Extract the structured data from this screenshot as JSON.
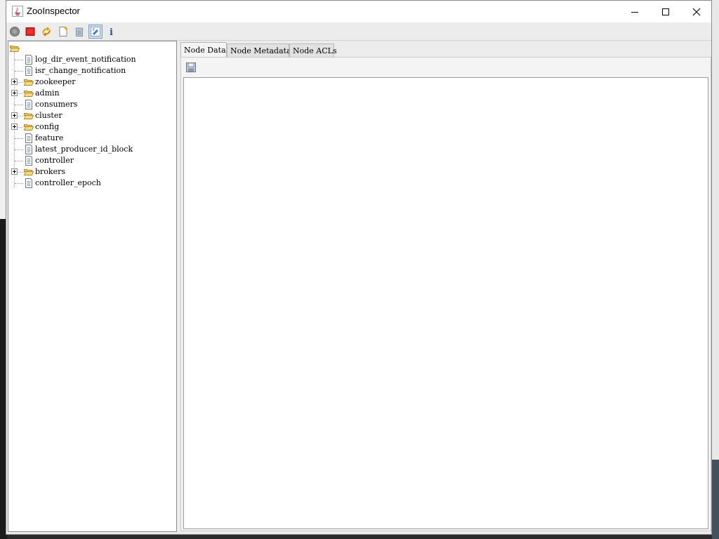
{
  "window": {
    "title": "ZooInspector"
  },
  "toolbar": {
    "buttons": [
      {
        "name": "connect-icon"
      },
      {
        "name": "disconnect-icon"
      },
      {
        "name": "refresh-icon"
      },
      {
        "name": "add-node-icon"
      },
      {
        "name": "delete-node-icon"
      },
      {
        "name": "node-viewers-icon"
      },
      {
        "name": "about-icon"
      }
    ]
  },
  "tree": {
    "root": "",
    "items": [
      {
        "label": "log_dir_event_notification",
        "type": "file",
        "expandable": false
      },
      {
        "label": "isr_change_notification",
        "type": "file",
        "expandable": false
      },
      {
        "label": "zookeeper",
        "type": "folder",
        "expandable": true
      },
      {
        "label": "admin",
        "type": "folder",
        "expandable": true
      },
      {
        "label": "consumers",
        "type": "file",
        "expandable": false
      },
      {
        "label": "cluster",
        "type": "folder",
        "expandable": true
      },
      {
        "label": "config",
        "type": "folder",
        "expandable": true
      },
      {
        "label": "feature",
        "type": "file",
        "expandable": false
      },
      {
        "label": "latest_producer_id_block",
        "type": "file",
        "expandable": false
      },
      {
        "label": "controller",
        "type": "file",
        "expandable": false
      },
      {
        "label": "brokers",
        "type": "folder",
        "expandable": true
      },
      {
        "label": "controller_epoch",
        "type": "file",
        "expandable": false
      }
    ]
  },
  "tabs": [
    {
      "label": "Node Data",
      "active": true
    },
    {
      "label": "Node Metadata",
      "active": false
    },
    {
      "label": "Node ACLs",
      "active": false
    }
  ],
  "editor": {
    "content": ""
  }
}
